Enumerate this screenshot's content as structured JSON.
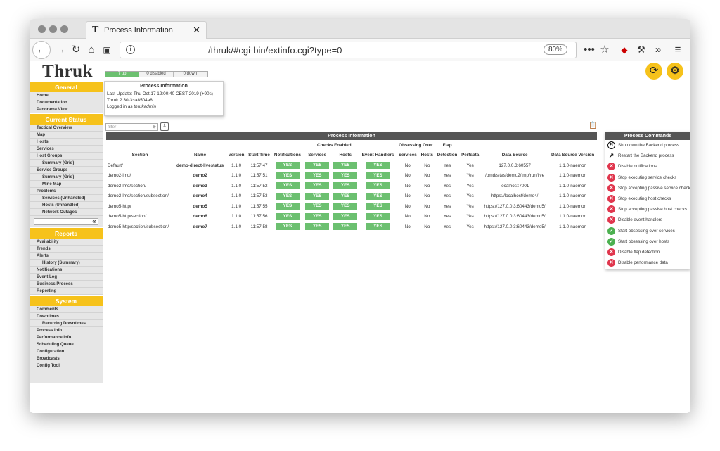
{
  "browser": {
    "tab_title": "Process Information",
    "tab_favicon": "T",
    "url": "/thruk/#cgi-bin/extinfo.cgi?type=0",
    "zoom": "80%"
  },
  "app": {
    "logo": "Thruk",
    "host_status": {
      "up": "7 up",
      "disabled": "0 disabled",
      "down": "0 down"
    }
  },
  "sidebar": {
    "sections": [
      {
        "title": "General",
        "items": [
          {
            "label": "Home",
            "sub": false
          },
          {
            "label": "Documentation",
            "sub": false
          },
          {
            "label": "Panorama View",
            "sub": false
          }
        ]
      },
      {
        "title": "Current Status",
        "items": [
          {
            "label": "Tactical Overview",
            "sub": false
          },
          {
            "label": "Map",
            "sub": false
          },
          {
            "label": "Hosts",
            "sub": false
          },
          {
            "label": "Services",
            "sub": false
          },
          {
            "label": "Host Groups",
            "sub": false
          },
          {
            "label": "Summary (Grid)",
            "sub": true
          },
          {
            "label": "Service Groups",
            "sub": false
          },
          {
            "label": "Summary (Grid)",
            "sub": true
          },
          {
            "label": "Mine Map",
            "sub": true
          },
          {
            "label": "Problems",
            "sub": false
          },
          {
            "label": "Services (Unhandled)",
            "sub": true
          },
          {
            "label": "Hosts (Unhandled)",
            "sub": true
          },
          {
            "label": "Network Outages",
            "sub": true
          }
        ]
      },
      {
        "title": "Reports",
        "items": [
          {
            "label": "Availability",
            "sub": false
          },
          {
            "label": "Trends",
            "sub": false
          },
          {
            "label": "Alerts",
            "sub": false
          },
          {
            "label": "History (Summary)",
            "sub": true
          },
          {
            "label": "Notifications",
            "sub": false
          },
          {
            "label": "Event Log",
            "sub": false
          },
          {
            "label": "Business Process",
            "sub": false
          },
          {
            "label": "Reporting",
            "sub": false
          }
        ]
      },
      {
        "title": "System",
        "items": [
          {
            "label": "Comments",
            "sub": false
          },
          {
            "label": "Downtimes",
            "sub": false
          },
          {
            "label": "Recurring Downtimes",
            "sub": true
          },
          {
            "label": "Process Info",
            "sub": false
          },
          {
            "label": "Performance Info",
            "sub": false
          },
          {
            "label": "Scheduling Queue",
            "sub": false
          },
          {
            "label": "Configuration",
            "sub": false
          },
          {
            "label": "Broadcasts",
            "sub": false
          },
          {
            "label": "Config Tool",
            "sub": false
          }
        ]
      }
    ]
  },
  "process_tooltip": {
    "title": "Process Information",
    "last_update": "Last Update: Thu Oct 17 12:00:40 CEST 2019 (+90s)",
    "version": "Thruk 2.30-3~a8504a8",
    "logged_in_prefix": "Logged in as ",
    "user": "thrukadmin"
  },
  "filter": {
    "placeholder": "filter"
  },
  "table": {
    "title": "Process Information",
    "group_headers": {
      "checks_enabled": "Checks Enabled",
      "obsessing_over": "Obsessing Over",
      "flap": "Flap"
    },
    "columns": [
      "Section",
      "Name",
      "Version",
      "Start Time",
      "Notifications",
      "Services",
      "Hosts",
      "Event Handlers",
      "Services",
      "Hosts",
      "Detection",
      "Perfdata",
      "Data Source",
      "Data Source Version"
    ],
    "rows": [
      {
        "section": "Default/",
        "name": "demo-direct-livestatus",
        "version": "1.1.0",
        "start": "11:57:47",
        "notif": "YES",
        "svc": "YES",
        "hosts": "YES",
        "eh": "YES",
        "obs_svc": "No",
        "obs_hosts": "No",
        "flap": "Yes",
        "perf": "Yes",
        "source": "127.0.0.3:60557",
        "source_ver": "1.1.0-naemon"
      },
      {
        "section": "demo2-lmd/",
        "name": "demo2",
        "version": "1.1.0",
        "start": "11:57:51",
        "notif": "YES",
        "svc": "YES",
        "hosts": "YES",
        "eh": "YES",
        "obs_svc": "No",
        "obs_hosts": "No",
        "flap": "Yes",
        "perf": "Yes",
        "source": "/omd/sites/demo2/tmp/run/live",
        "source_ver": "1.1.0-naemon"
      },
      {
        "section": "demo2-lmd/section/",
        "name": "demo3",
        "version": "1.1.0",
        "start": "11:57:52",
        "notif": "YES",
        "svc": "YES",
        "hosts": "YES",
        "eh": "YES",
        "obs_svc": "No",
        "obs_hosts": "No",
        "flap": "Yes",
        "perf": "Yes",
        "source": "localhost:7001",
        "source_ver": "1.1.0-naemon"
      },
      {
        "section": "demo2-lmd/section/subsection/",
        "name": "demo4",
        "version": "1.1.0",
        "start": "11:57:53",
        "notif": "YES",
        "svc": "YES",
        "hosts": "YES",
        "eh": "YES",
        "obs_svc": "No",
        "obs_hosts": "No",
        "flap": "Yes",
        "perf": "Yes",
        "source": "https://localhost/demo4/",
        "source_ver": "1.1.0-naemon"
      },
      {
        "section": "demo5-http/",
        "name": "demo5",
        "version": "1.1.0",
        "start": "11:57:55",
        "notif": "YES",
        "svc": "YES",
        "hosts": "YES",
        "eh": "YES",
        "obs_svc": "No",
        "obs_hosts": "No",
        "flap": "Yes",
        "perf": "Yes",
        "source": "https://127.0.0.3:60443/demo5/",
        "source_ver": "1.1.0-naemon"
      },
      {
        "section": "demo5-http/section/",
        "name": "demo6",
        "version": "1.1.0",
        "start": "11:57:56",
        "notif": "YES",
        "svc": "YES",
        "hosts": "YES",
        "eh": "YES",
        "obs_svc": "No",
        "obs_hosts": "No",
        "flap": "Yes",
        "perf": "Yes",
        "source": "https://127.0.0.3:60443/demo5/",
        "source_ver": "1.1.0-naemon"
      },
      {
        "section": "demo5-http/section/subsection/",
        "name": "demo7",
        "version": "1.1.0",
        "start": "11:57:58",
        "notif": "YES",
        "svc": "YES",
        "hosts": "YES",
        "eh": "YES",
        "obs_svc": "No",
        "obs_hosts": "No",
        "flap": "Yes",
        "perf": "Yes",
        "source": "https://127.0.0.3:60443/demo5/",
        "source_ver": "1.1.0-naemon"
      }
    ]
  },
  "commands": {
    "title": "Process Commands",
    "items": [
      {
        "label": "Shutdown the Backend process",
        "icon": "shutdown-icon",
        "kind": "black",
        "glyph": "✕"
      },
      {
        "label": "Restart the Backend process",
        "icon": "restart-icon",
        "kind": "line",
        "glyph": "↗"
      },
      {
        "label": "Disable notifications",
        "icon": "disable-icon",
        "kind": "red",
        "glyph": "✕"
      },
      {
        "label": "Stop executing service checks",
        "icon": "disable-icon",
        "kind": "red",
        "glyph": "✕"
      },
      {
        "label": "Stop accepting passive service checks",
        "icon": "disable-icon",
        "kind": "red",
        "glyph": "✕"
      },
      {
        "label": "Stop executing host checks",
        "icon": "disable-icon",
        "kind": "red",
        "glyph": "✕"
      },
      {
        "label": "Stop accepting passive host checks",
        "icon": "disable-icon",
        "kind": "red",
        "glyph": "✕"
      },
      {
        "label": "Disable event handlers",
        "icon": "disable-icon",
        "kind": "red",
        "glyph": "✕"
      },
      {
        "label": "Start obsessing over services",
        "icon": "enable-icon",
        "kind": "green",
        "glyph": "✓"
      },
      {
        "label": "Start obsessing over hosts",
        "icon": "enable-icon",
        "kind": "green",
        "glyph": "✓"
      },
      {
        "label": "Disable flap detection",
        "icon": "disable-icon",
        "kind": "red",
        "glyph": "✕"
      },
      {
        "label": "Disable performance data",
        "icon": "disable-icon",
        "kind": "red",
        "glyph": "✕"
      }
    ]
  }
}
